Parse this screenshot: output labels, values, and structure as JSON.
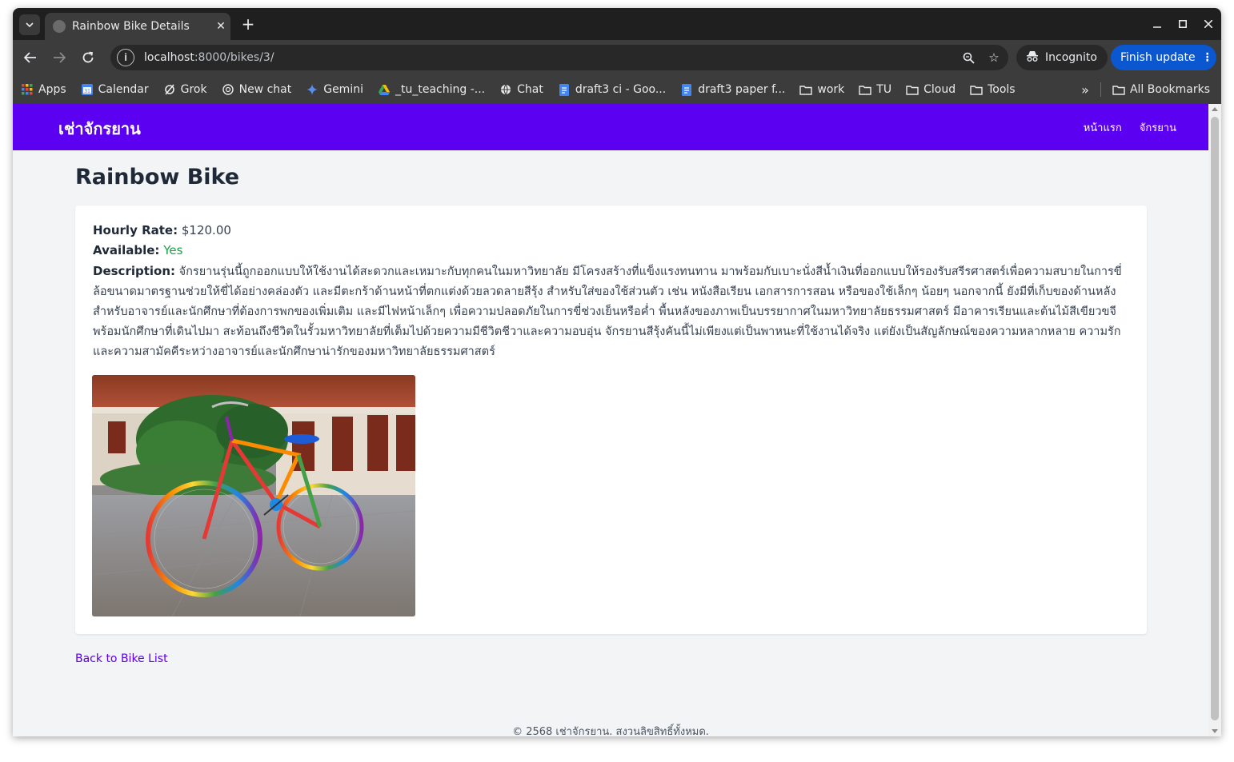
{
  "browser": {
    "tab_title": "Rainbow Bike Details",
    "url_host": "localhost",
    "url_path": ":8000/bikes/3/",
    "incognito_label": "Incognito",
    "update_label": "Finish update"
  },
  "bookmarks": [
    {
      "label": "Apps",
      "icon": "apps-grid-icon"
    },
    {
      "label": "Calendar",
      "icon": "calendar-icon"
    },
    {
      "label": "Grok",
      "icon": "grok-icon"
    },
    {
      "label": "New chat",
      "icon": "chatgpt-icon"
    },
    {
      "label": "Gemini",
      "icon": "gemini-icon"
    },
    {
      "label": "_tu_teaching -...",
      "icon": "drive-icon"
    },
    {
      "label": "Chat",
      "icon": "globe-icon"
    },
    {
      "label": "draft3 ci - Goo...",
      "icon": "docs-icon"
    },
    {
      "label": "draft3 paper f...",
      "icon": "docs-icon"
    },
    {
      "label": "work",
      "icon": "folder-icon"
    },
    {
      "label": "TU",
      "icon": "folder-icon"
    },
    {
      "label": "Cloud",
      "icon": "folder-icon"
    },
    {
      "label": "Tools",
      "icon": "folder-icon"
    }
  ],
  "bookmarks_overflow": "»",
  "all_bookmarks": "All Bookmarks",
  "site": {
    "brand": "เช่าจักรยาน",
    "nav": [
      "หน้าแรก",
      "จักรยาน"
    ]
  },
  "bike": {
    "name": "Rainbow Bike",
    "hourly_label": "Hourly Rate:",
    "hourly_value": "$120.00",
    "available_label": "Available:",
    "available_value": "Yes",
    "description_label": "Description:",
    "description": "จักรยานรุ่นนี้ถูกออกแบบให้ใช้งานได้สะดวกและเหมาะกับทุกคนในมหาวิทยาลัย มีโครงสร้างที่แข็งแรงทนทาน มาพร้อมกับเบาะนั่งสีน้ำเงินที่ออกแบบให้รองรับสรีรศาสตร์เพื่อความสบายในการขี่ ล้อขนาดมาตรฐานช่วยให้ขี่ได้อย่างคล่องตัว และมีตะกร้าด้านหน้าที่ตกแต่งด้วยลวดลายสีรุ้ง สำหรับใส่ของใช้ส่วนตัว เช่น หนังสือเรียน เอกสารการสอน หรือของใช้เล็กๆ น้อยๆ นอกจากนี้ ยังมีที่เก็บของด้านหลัง สำหรับอาจารย์และนักศึกษาที่ต้องการพกของเพิ่มเติม และมีไฟหน้าเล็กๆ เพื่อความปลอดภัยในการขี่ช่วงเย็นหรือค่ำ พื้นหลังของภาพเป็นบรรยากาศในมหาวิทยาลัยธรรมศาสตร์ มีอาคารเรียนและต้นไม้สีเขียวขจี พร้อมนักศึกษาที่เดินไปมา สะท้อนถึงชีวิตในรั้วมหาวิทยาลัยที่เต็มไปด้วยความมีชีวิตชีวาและความอบอุ่น จักรยานสีรุ้งคันนี้ไม่เพียงแต่เป็นพาหนะที่ใช้งานได้จริง แต่ยังเป็นสัญลักษณ์ของความหลากหลาย ความรัก และความสามัคคีระหว่างอาจารย์และนักศึกษาน่ารักของมหาวิทยาลัยธรรมศาสตร์",
    "back_link": "Back to Bike List"
  },
  "footer": "© 2568 เช่าจักรยาน. สงวนลิขสิทธิ์ทั้งหมด.",
  "colors": {
    "navbar": "#5b00f0",
    "available": "#16a34a",
    "link": "#5b00f0"
  }
}
